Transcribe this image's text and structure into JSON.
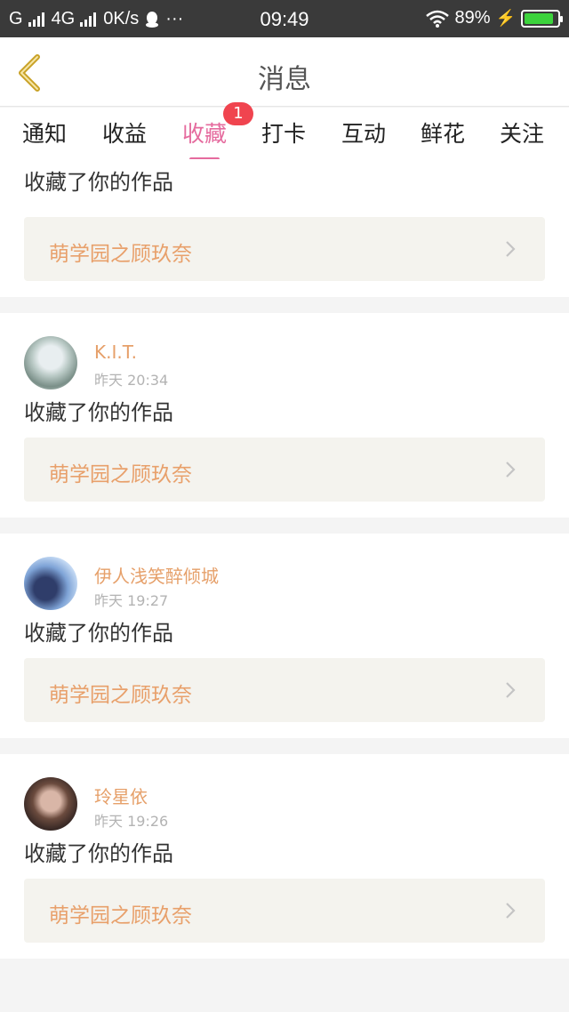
{
  "status_bar": {
    "carrier": "G",
    "network": "4G",
    "speed": "0K/s",
    "time": "09:49",
    "battery": "89%",
    "battery_level": 0.89,
    "icons": [
      "signal-icon",
      "qq-icon",
      "more-icon",
      "wifi-icon",
      "charging-icon",
      "battery-icon"
    ]
  },
  "header": {
    "title": "消息",
    "back_icon": "chevron-left-icon"
  },
  "tabs": [
    {
      "label": "通知"
    },
    {
      "label": "收益"
    },
    {
      "label": "收藏",
      "active": true,
      "badge": "1"
    },
    {
      "label": "打卡"
    },
    {
      "label": "互动"
    },
    {
      "label": "鲜花"
    },
    {
      "label": "关注"
    }
  ],
  "feed": [
    {
      "action": "收藏了你的作品",
      "work": "萌学园之顾玖奈"
    },
    {
      "user": "K.I.T.",
      "time": "昨天 20:34",
      "action": "收藏了你的作品",
      "work": "萌学园之顾玖奈"
    },
    {
      "user": "伊人浅笑醉倾城",
      "time": "昨天 19:27",
      "action": "收藏了你的作品",
      "work": "萌学园之顾玖奈"
    },
    {
      "user": "玲星依",
      "time": "昨天 19:26",
      "action": "收藏了你的作品",
      "work": "萌学园之顾玖奈"
    }
  ],
  "colors": {
    "accent_pink": "#e56b9e",
    "username_orange": "#e6a06a",
    "badge_red": "#f0444f",
    "status_bar": "#3a3a3a"
  }
}
